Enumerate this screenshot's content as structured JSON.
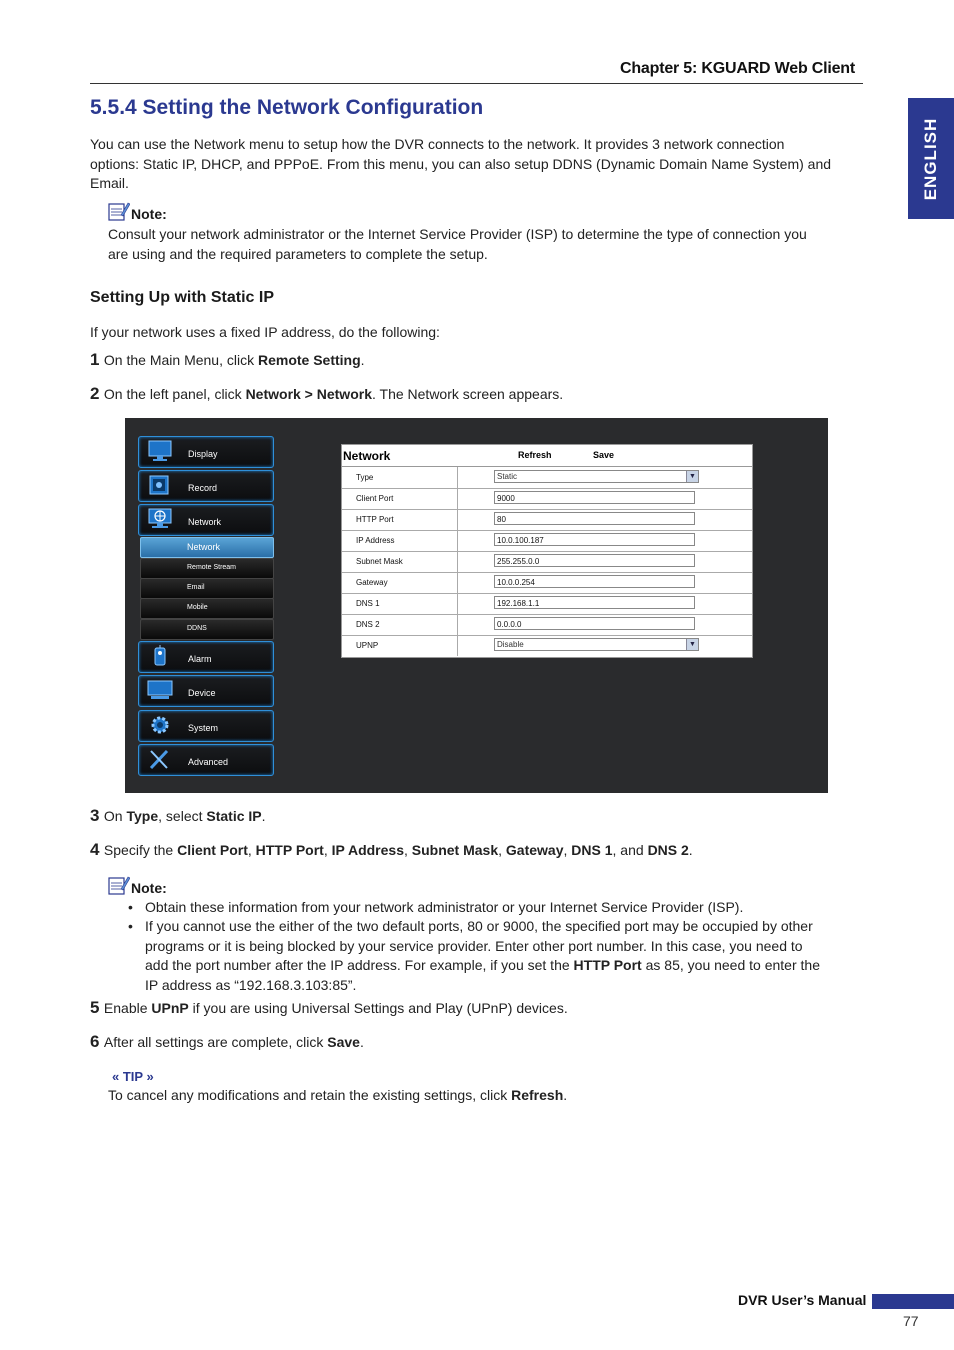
{
  "header": {
    "chapter": "Chapter 5: KGUARD Web Client",
    "lang_tab": "ENGLISH"
  },
  "title": "5.5.4 Setting the Network Configuration",
  "intro": [
    "You can use the Network menu to setup how the DVR connects to the network. It provides 3 network connection",
    "options: Static IP, DHCP, and PPPoE. From this menu, you can also setup DDNS (Dynamic Domain Name System) and",
    "Email."
  ],
  "note1": {
    "label": "Note:",
    "lines": [
      "Consult your network administrator or the Internet Service Provider (ISP) to determine the type of connection you",
      "are using and the required parameters to complete the setup."
    ]
  },
  "subheading": "Setting Up with Static IP",
  "lead": "If your network uses a fixed IP address, do the following:",
  "steps": {
    "s1": {
      "num": "1",
      "pre": "On the Main Menu, click ",
      "b1": "Remote Setting",
      "post": "."
    },
    "s2": {
      "num": "2",
      "pre": "On the left panel, click ",
      "b1": "Network > Network",
      "post": ". The Network screen appears."
    },
    "s3": {
      "num": "3",
      "pre": "On ",
      "b1": "Type",
      "mid": ", select ",
      "b2": "Static IP",
      "post": "."
    },
    "s4": {
      "num": "4",
      "pre": "Specify the ",
      "b1": "Client Port",
      "b2": "HTTP Port",
      "b3": "IP Address",
      "b4": "Subnet Mask",
      "b5": "Gateway",
      "b6": "DNS 1",
      "and": ", and ",
      "b7": "DNS 2",
      "comma": ", ",
      "post": "."
    },
    "s5": {
      "num": "5",
      "pre": "Enable ",
      "b1": "UPnP",
      "post": " if you are using Universal Settings and Play (UPnP) devices."
    },
    "s6": {
      "num": "6",
      "pre": "After all settings are complete, click ",
      "b1": "Save",
      "post": "."
    }
  },
  "note2": {
    "label": "Note:",
    "b1": "Obtain these information from your network administrator or your Internet Service Provider (ISP).",
    "b2_l1": "If you cannot use the either of the two default ports, 80 or 9000, the specified port may be occupied by other",
    "b2_l2": "programs or it is being blocked by your service provider. Enter other port number. In this case, you need to",
    "b2_l3_pre": "add the port number after the IP address. For example, if you set the ",
    "b2_l3_bold": "HTTP Port",
    "b2_l3_post": " as 85, you need to enter the",
    "b2_l4": "IP address as “192.168.3.103:85”."
  },
  "tip": {
    "label": "« TIP »",
    "pre": "To cancel any modifications and retain the existing settings, click ",
    "bold": "Refresh",
    "post": "."
  },
  "footer": {
    "manual": "DVR User’s Manual",
    "page": "77"
  },
  "screenshot": {
    "menu": [
      {
        "label": "Display",
        "icon": "monitor-icon"
      },
      {
        "label": "Record",
        "icon": "record-icon"
      },
      {
        "label": "Network",
        "icon": "network-icon"
      },
      {
        "label": "Alarm",
        "icon": "alarm-icon"
      },
      {
        "label": "Device",
        "icon": "device-icon"
      },
      {
        "label": "System",
        "icon": "gear-icon"
      },
      {
        "label": "Advanced",
        "icon": "tools-icon"
      }
    ],
    "submenu": [
      "Network",
      "Remote Stream",
      "Email",
      "Mobile",
      "DDNS"
    ],
    "form": {
      "title": "Network",
      "refresh": "Refresh",
      "save": "Save",
      "rows": [
        {
          "label": "Type",
          "value": "Static",
          "kind": "select"
        },
        {
          "label": "Client Port",
          "value": "9000",
          "kind": "input"
        },
        {
          "label": "HTTP Port",
          "value": "80",
          "kind": "input"
        },
        {
          "label": "IP Address",
          "value": "10.0.100.187",
          "kind": "input"
        },
        {
          "label": "Subnet Mask",
          "value": "255.255.0.0",
          "kind": "input"
        },
        {
          "label": "Gateway",
          "value": "10.0.0.254",
          "kind": "input"
        },
        {
          "label": "DNS 1",
          "value": "192.168.1.1",
          "kind": "input"
        },
        {
          "label": "DNS 2",
          "value": "0.0.0.0",
          "kind": "input"
        },
        {
          "label": "UPNP",
          "value": "Disable",
          "kind": "select"
        }
      ]
    }
  }
}
